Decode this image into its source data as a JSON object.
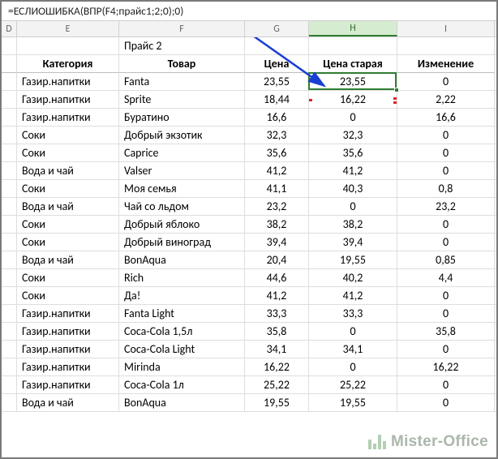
{
  "formula": "=ЕСЛИОШИБКА(ВПР(F4;прайс1;2;0);0)",
  "columns": {
    "D": "D",
    "E": "E",
    "F": "F",
    "G": "G",
    "H": "H",
    "I": "I"
  },
  "selected_column": "H",
  "section_title": "Прайс 2",
  "headers": {
    "category": "Категория",
    "item": "Товар",
    "price": "Цена",
    "old_price": "Цена старая",
    "change": "Изменение"
  },
  "rows": [
    {
      "category": "Газир.напитки",
      "item": "Fanta",
      "price": "23,55",
      "old_price": "23,55",
      "change": "0"
    },
    {
      "category": "Газир.напитки",
      "item": "Sprite",
      "price": "18,44",
      "old_price": "16,22",
      "change": "2,22",
      "mark": "diff"
    },
    {
      "category": "Газир.напитки",
      "item": "Буратино",
      "price": "16,6",
      "old_price": "0",
      "change": "16,6"
    },
    {
      "category": "Соки",
      "item": "Добрый экзотик",
      "price": "32,3",
      "old_price": "32,3",
      "change": "0"
    },
    {
      "category": "Соки",
      "item": "Caprice",
      "price": "35,6",
      "old_price": "35,6",
      "change": "0"
    },
    {
      "category": "Вода и чай",
      "item": "Valser",
      "price": "41,2",
      "old_price": "41,2",
      "change": "0"
    },
    {
      "category": "Соки",
      "item": "Моя семья",
      "price": "41,1",
      "old_price": "40,3",
      "change": "0,8"
    },
    {
      "category": "Вода и чай",
      "item": "Чай со льдом",
      "price": "23,2",
      "old_price": "0",
      "change": "23,2"
    },
    {
      "category": "Соки",
      "item": "Добрый яблоко",
      "price": "38,2",
      "old_price": "38,2",
      "change": "0"
    },
    {
      "category": "Соки",
      "item": "Добрый виноград",
      "price": "39,4",
      "old_price": "39,4",
      "change": "0"
    },
    {
      "category": "Вода и чай",
      "item": "BonAqua",
      "price": "20,4",
      "old_price": "19,55",
      "change": "0,85"
    },
    {
      "category": "Соки",
      "item": "Rich",
      "price": "44,6",
      "old_price": "40,2",
      "change": "4,4"
    },
    {
      "category": "Соки",
      "item": "Да!",
      "price": "41,2",
      "old_price": "41,2",
      "change": "0"
    },
    {
      "category": "Газир.напитки",
      "item": "Fanta Light",
      "price": "33,3",
      "old_price": "33,3",
      "change": "0"
    },
    {
      "category": "Газир.напитки",
      "item": "Coca-Cola 1,5л",
      "price": "35,8",
      "old_price": "0",
      "change": "35,8"
    },
    {
      "category": "Газир.напитки",
      "item": "Coca-Cola Light",
      "price": "34,1",
      "old_price": "34,1",
      "change": "0"
    },
    {
      "category": "Газир.напитки",
      "item": "Mirinda",
      "price": "16,22",
      "old_price": "0",
      "change": "16,22"
    },
    {
      "category": "Газир.напитки",
      "item": "Coca-Cola 1л",
      "price": "25,22",
      "old_price": "25,22",
      "change": "0"
    },
    {
      "category": "Вода и чай",
      "item": "BonAqua",
      "price": "19,55",
      "old_price": "19,55",
      "change": "0"
    }
  ],
  "active_cell": {
    "col": "H",
    "row_index": 0
  },
  "watermark": "Mister-Office"
}
